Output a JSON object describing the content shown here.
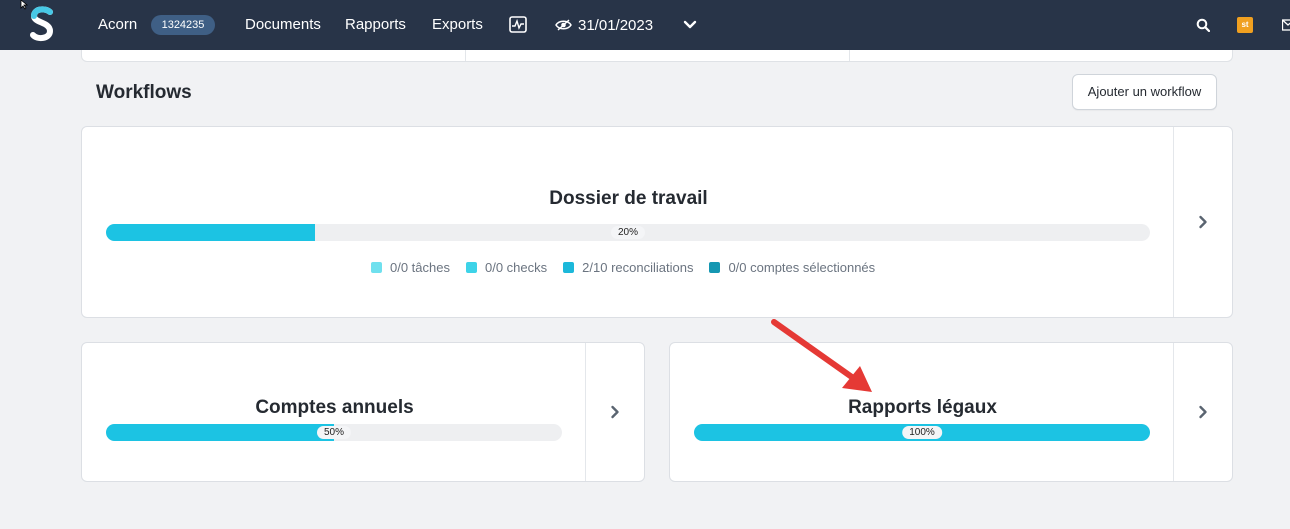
{
  "nav": {
    "company": "Acorn",
    "company_id": "1324235",
    "documents": "Documents",
    "rapports": "Rapports",
    "exports": "Exports",
    "date": "31/01/2023",
    "user_badge": "st"
  },
  "workflows": {
    "title": "Workflows",
    "add_button": "Ajouter un workflow",
    "cards": [
      {
        "title": "Dossier de travail",
        "progress": 0.2,
        "progress_label": "20%",
        "legend": [
          {
            "label": "0/0 tâches",
            "color": "#6fe0ee"
          },
          {
            "label": "0/0 checks",
            "color": "#3dd3e8"
          },
          {
            "label": "2/10 reconciliations",
            "color": "#1cb8da"
          },
          {
            "label": "0/0 comptes sélectionnés",
            "color": "#1597b2"
          }
        ]
      },
      {
        "title": "Comptes annuels",
        "progress": 0.5,
        "progress_label": "50%"
      },
      {
        "title": "Rapports légaux",
        "progress": 1.0,
        "progress_label": "100%"
      }
    ]
  },
  "colors": {
    "nav_bg": "#283448",
    "progress_fill": "#1cc3e3",
    "annotation_arrow": "#e53935"
  }
}
